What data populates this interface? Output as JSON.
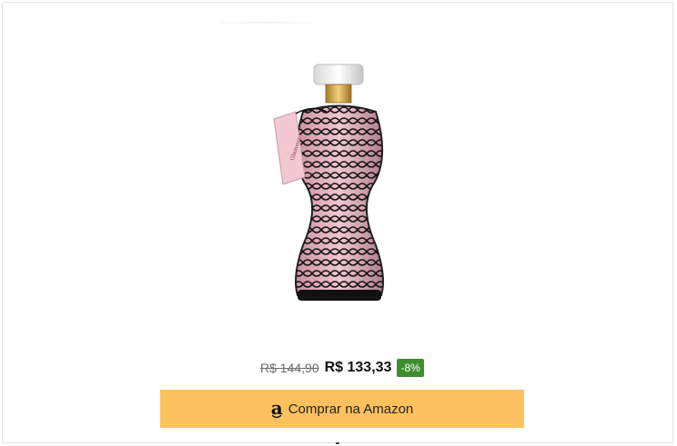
{
  "product": {
    "image_icon": "perfume-bottle-image",
    "tag_text": "Glamour Secrets Black"
  },
  "pricing": {
    "old_price": "R$ 144,90",
    "new_price": "R$ 133,33",
    "discount": "-8%"
  },
  "button": {
    "icon": "amazon-icon",
    "icon_glyph": "a",
    "label": "Comprar na Amazon",
    "color": "#fec15f"
  },
  "colors": {
    "discount_badge": "#3e8e2f",
    "bottle_pink": "#e9b7c3"
  }
}
